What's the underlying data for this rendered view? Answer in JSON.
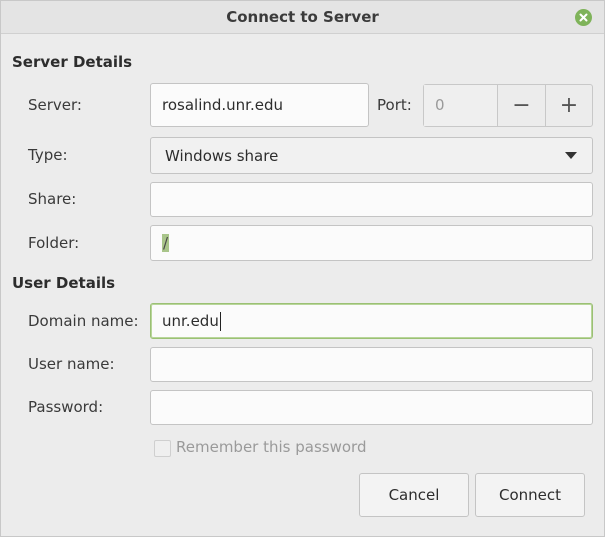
{
  "window": {
    "title": "Connect to Server"
  },
  "server_details": {
    "heading": "Server Details",
    "server_label": "Server:",
    "server_value": "rosalind.unr.edu",
    "port_label": "Port:",
    "port_value": "0",
    "port_decrement": "−",
    "port_increment": "+",
    "type_label": "Type:",
    "type_value": "Windows share",
    "share_label": "Share:",
    "share_value": "",
    "folder_label": "Folder:",
    "folder_value": "/"
  },
  "user_details": {
    "heading": "User Details",
    "domain_label": "Domain name:",
    "domain_value": "unr.edu",
    "username_label": "User name:",
    "username_value": "",
    "password_label": "Password:",
    "password_value": "",
    "remember_label": "Remember this password",
    "remember_checked": false
  },
  "actions": {
    "cancel_label": "Cancel",
    "connect_label": "Connect"
  },
  "colors": {
    "accent": "#7fb35a",
    "focus_border": "#9bc074",
    "selection": "#a9c58a"
  },
  "icons": {
    "close": "close-icon",
    "dropdown": "chevron-down-icon"
  }
}
